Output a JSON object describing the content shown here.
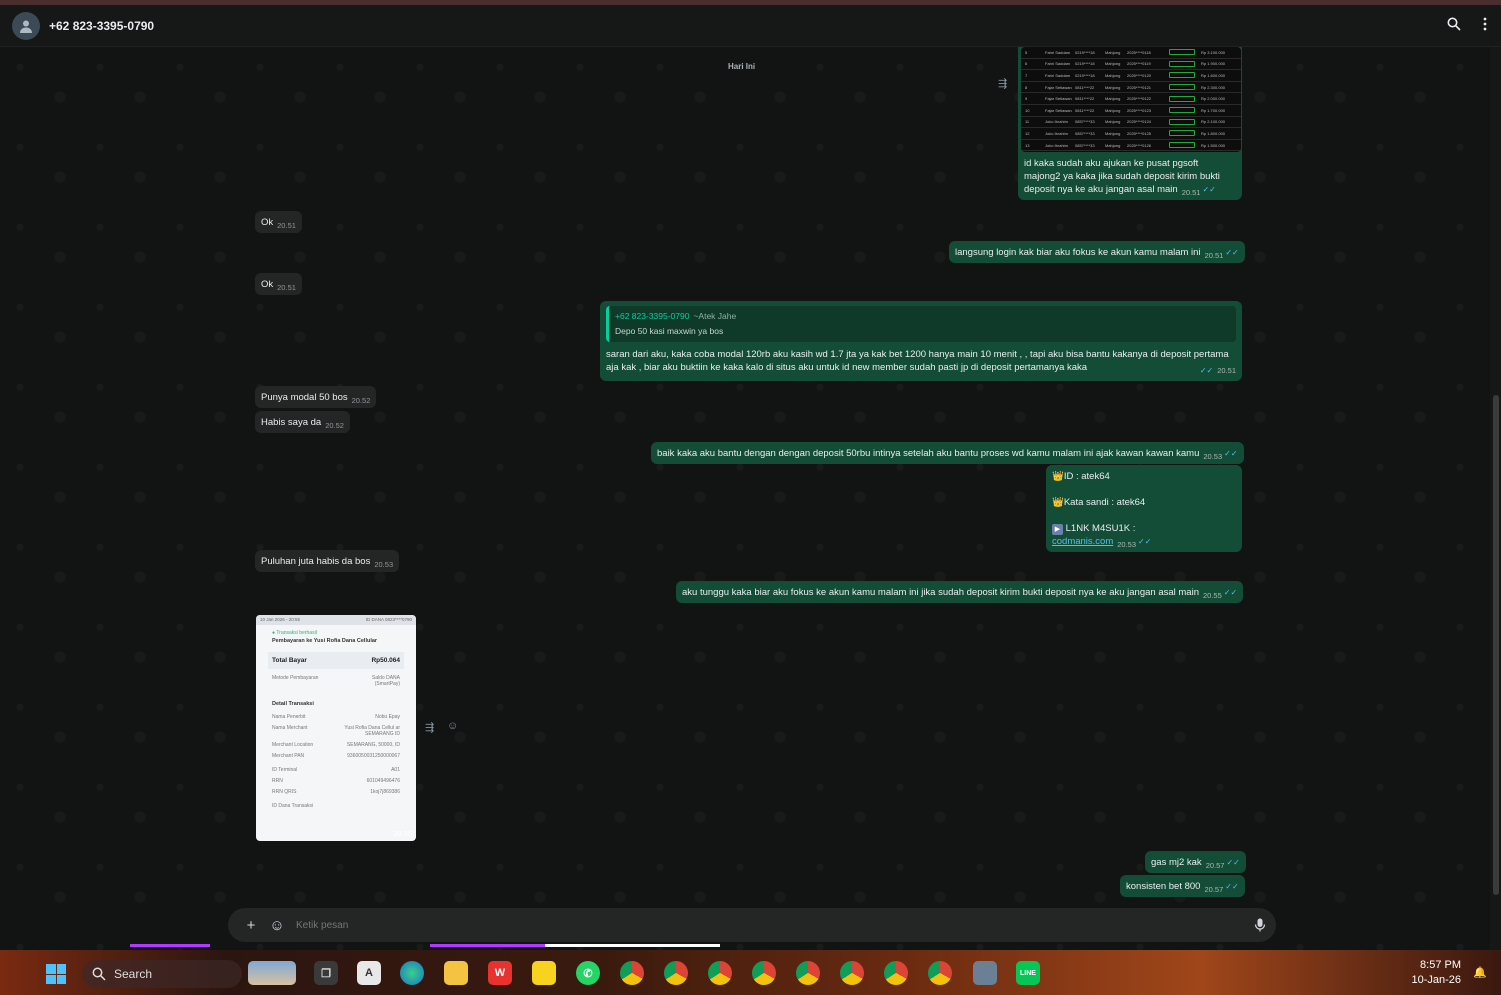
{
  "header": {
    "contact_name": "+62 823-3395-0790"
  },
  "date_divider": "Hari Ini",
  "messages": {
    "m1": {
      "text": "id kaka sudah aku ajukan ke pusat pgsoft majong2 ya kaka jika sudah deposit kirim bukti deposit nya ke aku jangan asal main",
      "time": "20.51"
    },
    "m2": {
      "text": "Ok",
      "time": "20.51"
    },
    "m3": {
      "text": "langsung login kak biar aku fokus ke akun kamu malam ini",
      "time": "20.51"
    },
    "m4": {
      "text": "Ok",
      "time": "20.51"
    },
    "m5": {
      "reply_name": "+62 823-3395-0790",
      "reply_alias": "~Atek Jahe",
      "reply_text": "Depo 50 kasi maxwin ya bos",
      "text": "saran dari aku, kaka coba modal 120rb aku kasih wd 1.7 jta ya kak bet 1200 hanya main 10 menit , , tapi aku bisa bantu kakanya di deposit pertama aja kak , biar aku buktiin ke kaka kalo di situs aku untuk id new member sudah pasti jp di deposit pertamanya kaka",
      "time": "20.51"
    },
    "m6": {
      "text": "Punya modal 50 bos",
      "time": "20.52"
    },
    "m7": {
      "text": "Habis saya da",
      "time": "20.52"
    },
    "m8": {
      "text": "baik kaka aku bantu dengan dengan deposit 50rbu intinya setelah aku bantu proses wd kamu malam ini ajak kawan kawan kamu",
      "time": "20.53"
    },
    "m9": {
      "id_line": "ID :  atek64",
      "pass_line": "Kata sandi : atek64",
      "link_label": "L1NK M4SU1K : ",
      "link_url": "codmanis.com",
      "time": "20.53"
    },
    "m10": {
      "text": "Puluhan juta habis da bos",
      "time": "20.53"
    },
    "m11": {
      "text": "aku tunggu kaka biar aku fokus ke akun kamu malam ini jika sudah deposit kirim bukti deposit nya ke aku jangan asal main",
      "time": "20.55"
    },
    "m12": {
      "time": "20.56"
    },
    "m13": {
      "text": "gas mj2 kak",
      "time": "20.57"
    },
    "m14": {
      "text": "konsisten bet 800",
      "time": "20.57"
    }
  },
  "receipt": {
    "top_left": "10 Jan 2026 - 20:55",
    "top_right": "ID DANA 0823****0790",
    "status": "Transaksi berhasil",
    "title": "Pembayaran ke Yusi Rofia Dana Cellular",
    "total_label": "Total Bayar",
    "total_value": "Rp50.064",
    "method_label": "Metode Pembayaran",
    "method_value": "Saldo DANA (SmartPay)",
    "detail_title": "Detail Transaksi",
    "rows": [
      {
        "k": "Nama Penerbit",
        "v": "Nobu Epay"
      },
      {
        "k": "Nama Merchant",
        "v": "Yusi Rofia Dana Cellul ar SEMARANG ID"
      },
      {
        "k": "Merchant Location",
        "v": "SEMARANG, 50000, ID"
      },
      {
        "k": "Merchant PAN",
        "v": "9360050031250000067"
      },
      {
        "k": "ID Terminal",
        "v": "A01"
      },
      {
        "k": "RRN",
        "v": "601049496476"
      },
      {
        "k": "RRN QRIS",
        "v": "1koj7j869386"
      }
    ],
    "bottom": "ID Dana Transaksi"
  },
  "composer": {
    "placeholder": "Ketik pesan"
  },
  "taskbar": {
    "search_label": "Search",
    "time": "8:57 PM",
    "date": "10-Jan-26"
  },
  "colors": {
    "outgoing_bubble": "#144d37",
    "incoming_bubble": "#242626",
    "accent": "#06cf9c",
    "read_ticks": "#53bdeb"
  }
}
